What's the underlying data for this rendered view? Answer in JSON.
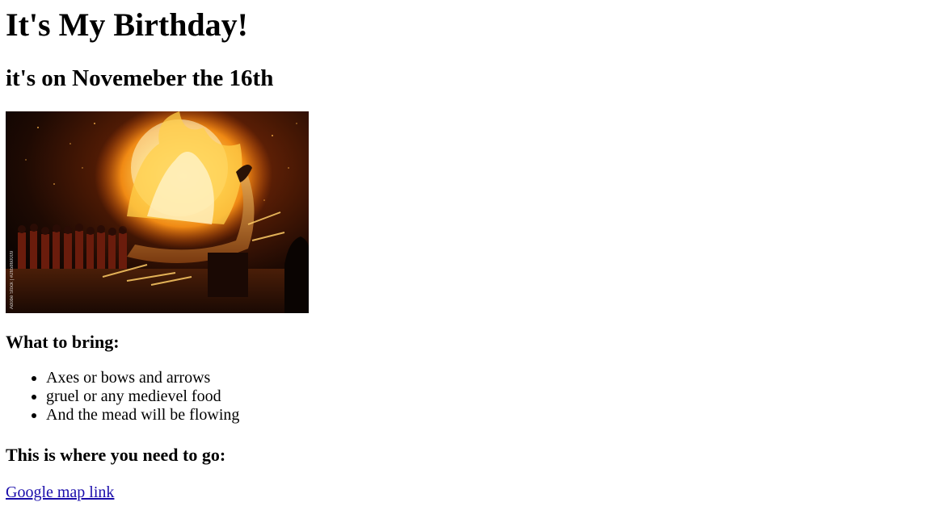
{
  "page": {
    "title": "It's My Birthday!",
    "subtitle": "it's on Novemeber the 16th",
    "image": {
      "description_icon": "viking-ship-bonfire-photo",
      "watermark": "Adobe Stock | #265860009"
    },
    "bring_heading": "What to bring:",
    "bring_items": [
      "Axes or bows and arrows",
      "gruel or any medievel food",
      "And the mead will be flowing"
    ],
    "go_heading": "This is where you need to go:",
    "map_link_label": "Google map link"
  },
  "colors": {
    "link": "#1a0dab",
    "text": "#000000",
    "background": "#ffffff"
  }
}
